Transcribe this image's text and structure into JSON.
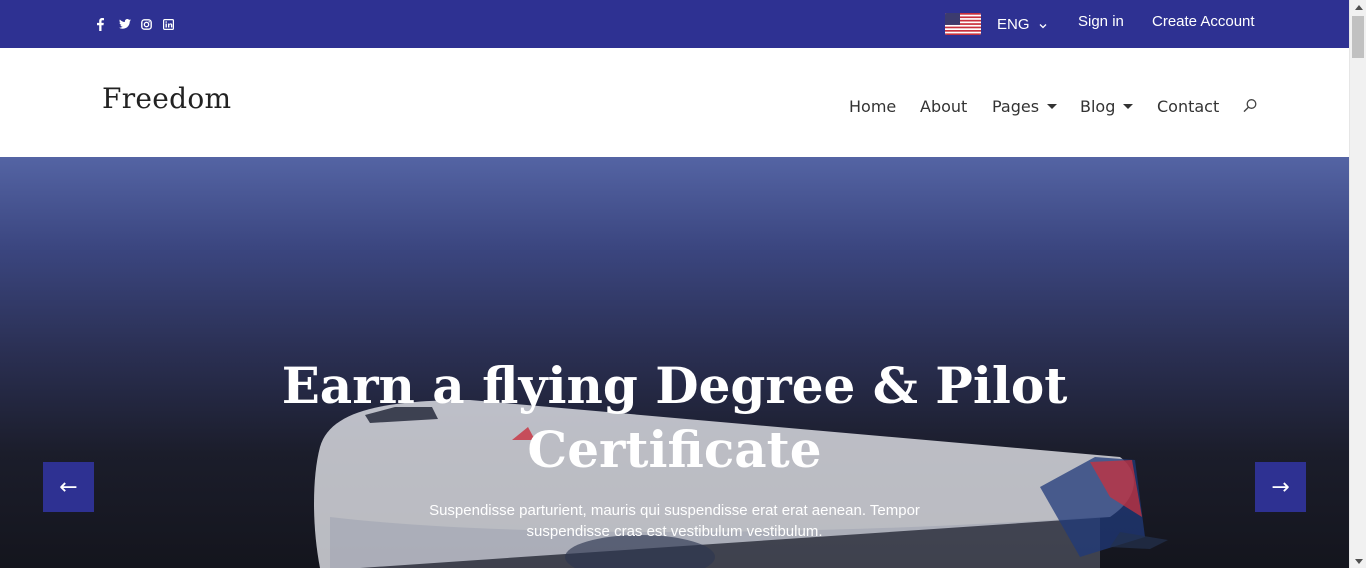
{
  "topbar": {
    "social_icons": [
      "facebook-icon",
      "twitter-icon",
      "instagram-icon",
      "linkedin-icon"
    ],
    "language": "ENG",
    "sign_in": "Sign in",
    "create_account": "Create Account",
    "background_color": "#2e3192"
  },
  "header": {
    "logo": "Freedom",
    "nav": {
      "home": "Home",
      "about": "About",
      "pages": "Pages",
      "blog": "Blog",
      "contact": "Contact"
    }
  },
  "hero": {
    "title_line1": "Earn a flying Degree & Pilot",
    "title_line2": "Certificate",
    "subtitle_line1": "Suspendisse parturient, mauris qui suspendisse erat erat aenean. Tempor",
    "subtitle_line2": "suspendisse cras est vestibulum vestibulum.",
    "prev_arrow": "←",
    "next_arrow": "→",
    "accent_color": "#2e3192"
  }
}
